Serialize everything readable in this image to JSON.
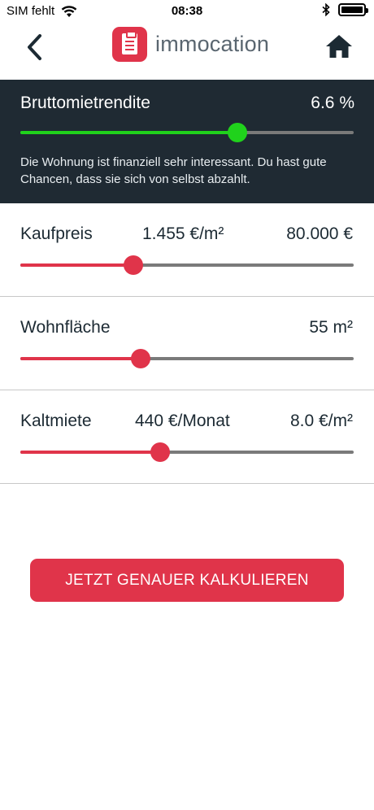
{
  "status_bar": {
    "carrier": "SIM fehlt",
    "time": "08:38"
  },
  "header": {
    "app_name": "immocation"
  },
  "summary": {
    "title": "Bruttomietrendite",
    "value": "6.6 %",
    "slider_fraction": 0.65,
    "description": "Die Wohnung ist finanziell sehr interessant. Du hast gute Chancen, dass sie sich von selbst abzahlt."
  },
  "rows": [
    {
      "label": "Kaufpreis",
      "mid": "1.455 €/m²",
      "right": "80.000 €",
      "slider_fraction": 0.34
    },
    {
      "label": "Wohnfläche",
      "mid": "",
      "right": "55 m²",
      "slider_fraction": 0.36
    },
    {
      "label": "Kaltmiete",
      "mid": "440 €/Monat",
      "right": "8.0 €/m²",
      "slider_fraction": 0.42
    }
  ],
  "cta": {
    "label": "JETZT GENAUER KALKULIEREN"
  },
  "colors": {
    "accent": "#e0344a",
    "good": "#20d21c",
    "panel": "#1f2a33"
  }
}
